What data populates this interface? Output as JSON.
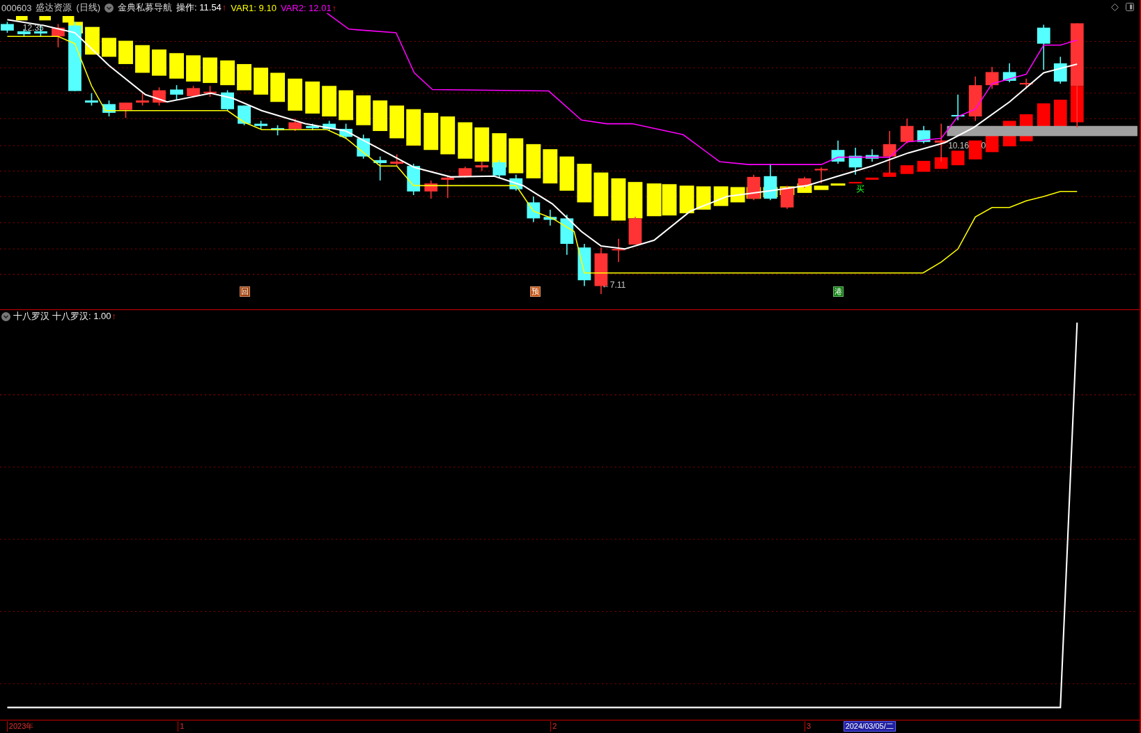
{
  "header": {
    "symbol": "000603",
    "name": "盛达资源",
    "period": "(日线)",
    "indicator": "金典私募导航",
    "values": [
      {
        "label": "操作: 11.54",
        "color": "#ffffff",
        "arrow": "↑"
      },
      {
        "label": "VAR1: 9.10",
        "color": "#ffff00"
      },
      {
        "label": "VAR2: 12.01",
        "color": "#ff00ff",
        "arrow": "↑"
      }
    ]
  },
  "price_labels": [
    "12.35",
    "←7.11",
    "10.16",
    "0"
  ],
  "markers": [
    {
      "text": "回",
      "color": "#a0400a"
    },
    {
      "text": "预",
      "color": "#c05010"
    },
    {
      "text": "港",
      "color": "#108010"
    }
  ],
  "signal": "买",
  "lower_panel": {
    "title": "十八罗汉",
    "value": "十八罗汉: 1.00",
    "arrow": "↑"
  },
  "time_axis": {
    "labels": [
      "2023年",
      "1",
      "2",
      "3"
    ],
    "cursor_date": "2024/03/05/二"
  }
}
